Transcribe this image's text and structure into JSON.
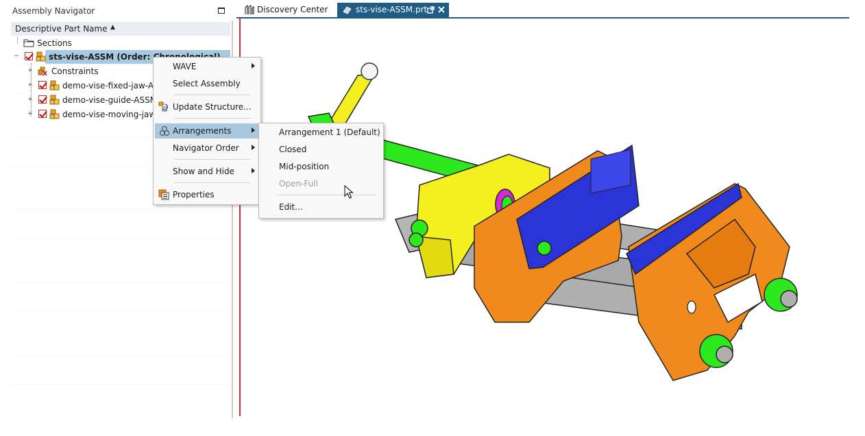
{
  "navigator": {
    "title": "Assembly Navigator",
    "column_header": "Descriptive Part Name",
    "rows": [
      {
        "label": "Sections"
      },
      {
        "label": "sts-vise-ASSM (Order: Chronological)"
      },
      {
        "label": "Constraints"
      },
      {
        "label": "demo-vise-fixed-jaw-ASSM"
      },
      {
        "label": "demo-vise-guide-ASSM"
      },
      {
        "label": "demo-vise-moving-jaw-ASSM"
      }
    ]
  },
  "tabs": {
    "discovery": "Discovery Center",
    "part": "sts-vise-ASSM.prt"
  },
  "context_menu": {
    "items": [
      {
        "label": "WAVE"
      },
      {
        "label": "Select Assembly"
      },
      {
        "label": "Update Structure..."
      },
      {
        "label": "Arrangements"
      },
      {
        "label": "Navigator Order"
      },
      {
        "label": "Show and Hide"
      },
      {
        "label": "Properties"
      }
    ]
  },
  "arrangements_submenu": {
    "items": [
      {
        "label": "Arrangement 1 (Default)"
      },
      {
        "label": "Closed"
      },
      {
        "label": "Mid-position"
      },
      {
        "label": "Open-Full",
        "enabled": false
      },
      {
        "label": "Edit..."
      }
    ]
  },
  "colors": {
    "tab_active": "#1f5c86",
    "selection": "#a7c9e2",
    "graphics_border": "#d9302c",
    "jaw_orange": "#f08a1c",
    "jaw_plate_blue": "#2b34d6",
    "handle_yellow": "#f4ef1e",
    "screw_green": "#2ee81e",
    "rod_gray": "#a9a9a9"
  }
}
